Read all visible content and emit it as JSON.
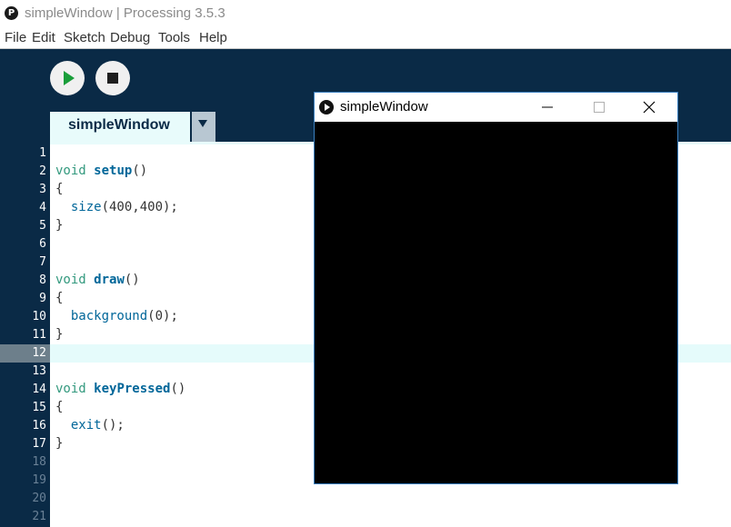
{
  "window": {
    "title": "simpleWindow | Processing 3.5.3",
    "icon": "processing-logo-icon"
  },
  "menu": [
    "File",
    "Edit",
    "Sketch",
    "Debug",
    "Tools",
    "Help"
  ],
  "toolbar": {
    "run_icon": "play-icon",
    "stop_icon": "stop-icon"
  },
  "tabs": [
    {
      "label": "simpleWindow",
      "active": true
    }
  ],
  "editor": {
    "current_line": 12,
    "lines": [
      {
        "num": "1",
        "text": ""
      },
      {
        "num": "2",
        "text": "void setup()"
      },
      {
        "num": "3",
        "text": "{"
      },
      {
        "num": "4",
        "text": "  size(400,400);"
      },
      {
        "num": "5",
        "text": "}"
      },
      {
        "num": "6",
        "text": ""
      },
      {
        "num": "7",
        "text": ""
      },
      {
        "num": "8",
        "text": "void draw()"
      },
      {
        "num": "9",
        "text": "{"
      },
      {
        "num": "10",
        "text": "  background(0);"
      },
      {
        "num": "11",
        "text": "}"
      },
      {
        "num": "12",
        "text": ""
      },
      {
        "num": "13",
        "text": ""
      },
      {
        "num": "14",
        "text": "void keyPressed()"
      },
      {
        "num": "15",
        "text": "{"
      },
      {
        "num": "16",
        "text": "  exit();"
      },
      {
        "num": "17",
        "text": "}"
      },
      {
        "num": "18",
        "text": ""
      },
      {
        "num": "19",
        "text": ""
      },
      {
        "num": "20",
        "text": ""
      },
      {
        "num": "21",
        "text": ""
      }
    ]
  },
  "sketch_window": {
    "title": "simpleWindow",
    "canvas_color": "#000000"
  },
  "colors": {
    "editor_bg": "#0a2a46",
    "keyword": "#33997e",
    "function": "#006699"
  }
}
